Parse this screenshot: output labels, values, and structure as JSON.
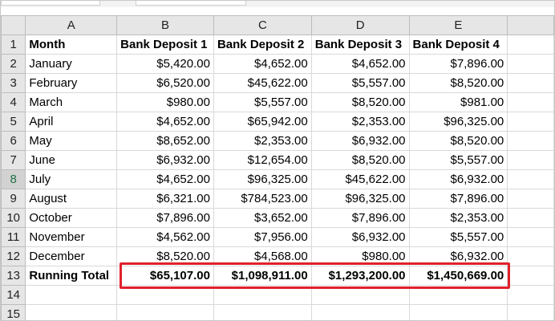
{
  "columns": [
    "A",
    "B",
    "C",
    "D",
    "E"
  ],
  "header": [
    "Month",
    "Bank Deposit 1",
    "Bank Deposit 2",
    "Bank Deposit 3",
    "Bank Deposit 4"
  ],
  "rows": [
    [
      "January",
      "$5,420.00",
      "$4,652.00",
      "$4,652.00",
      "$7,896.00"
    ],
    [
      "February",
      "$6,520.00",
      "$45,622.00",
      "$5,557.00",
      "$8,520.00"
    ],
    [
      "March",
      "$980.00",
      "$5,557.00",
      "$8,520.00",
      "$981.00"
    ],
    [
      "April",
      "$4,652.00",
      "$65,942.00",
      "$2,353.00",
      "$96,325.00"
    ],
    [
      "May",
      "$8,652.00",
      "$2,353.00",
      "$6,932.00",
      "$8,520.00"
    ],
    [
      "June",
      "$6,932.00",
      "$12,654.00",
      "$8,520.00",
      "$5,557.00"
    ],
    [
      "July",
      "$4,652.00",
      "$96,325.00",
      "$45,622.00",
      "$6,932.00"
    ],
    [
      "August",
      "$6,321.00",
      "$784,523.00",
      "$96,325.00",
      "$7,896.00"
    ],
    [
      "October",
      "$7,896.00",
      "$3,652.00",
      "$7,896.00",
      "$2,353.00"
    ],
    [
      "November",
      "$4,562.00",
      "$7,956.00",
      "$6,932.00",
      "$5,557.00"
    ],
    [
      "December",
      "$8,520.00",
      "$4,568.00",
      "$980.00",
      "$6,932.00"
    ]
  ],
  "total": [
    "Running Total",
    "$65,107.00",
    "$1,098,911.00",
    "$1,293,200.00",
    "$1,450,669.00"
  ],
  "row_numbers": [
    "1",
    "2",
    "3",
    "4",
    "5",
    "6",
    "7",
    "8",
    "9",
    "10",
    "11",
    "12",
    "13",
    "14",
    "15"
  ],
  "active_row": "8",
  "colors": {
    "highlight_border": "#e0212b",
    "active_header_text": "#217346",
    "grid": "#d9d9d9"
  }
}
